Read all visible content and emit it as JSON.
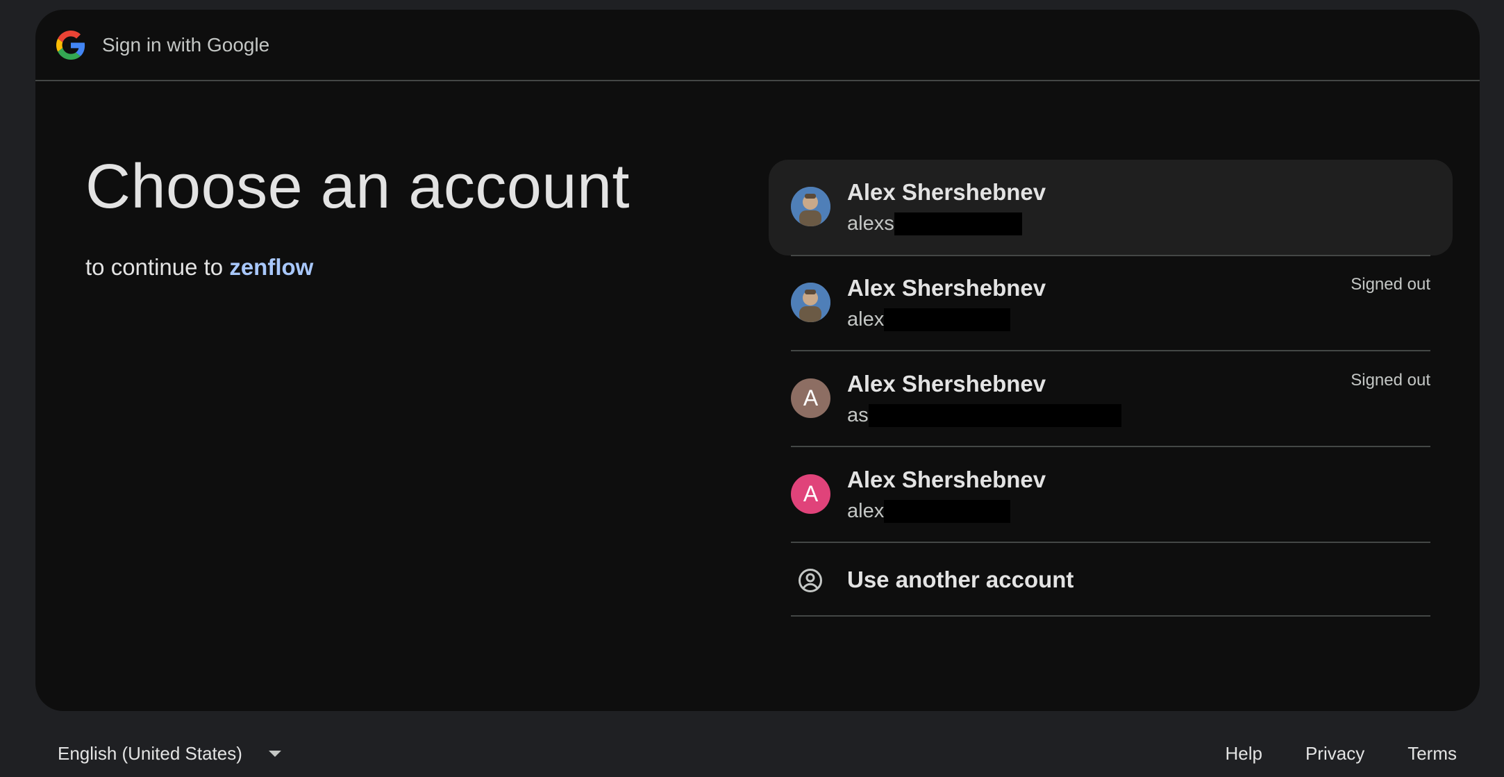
{
  "header": {
    "title": "Sign in with Google",
    "logo_icon": "google-g-icon"
  },
  "main": {
    "headline": "Choose an account",
    "subline_prefix": "to continue to",
    "app_name": "zenflow"
  },
  "accounts": [
    {
      "name": "Alex Shershebnev",
      "email_visible": "alexs",
      "status": "",
      "avatar": "photo",
      "selected": true
    },
    {
      "name": "Alex Shershebnev",
      "email_visible": "alex",
      "status": "Signed out",
      "avatar": "photo",
      "selected": false
    },
    {
      "name": "Alex Shershebnev",
      "email_visible": "as",
      "status": "Signed out",
      "avatar": "A",
      "avatar_color": "#8d6e63",
      "selected": false
    },
    {
      "name": "Alex Shershebnev",
      "email_visible": "alex",
      "status": "",
      "avatar": "A",
      "avatar_color": "#e0437a",
      "selected": false
    }
  ],
  "use_another": {
    "label": "Use another account",
    "icon": "account-circle-icon"
  },
  "footer": {
    "language": "English (United States)",
    "links": [
      "Help",
      "Privacy",
      "Terms"
    ]
  },
  "colors": {
    "background": "#1f2023",
    "card": "#0e0e0e",
    "accent_link": "#a8c7fa",
    "divider": "#444746"
  }
}
